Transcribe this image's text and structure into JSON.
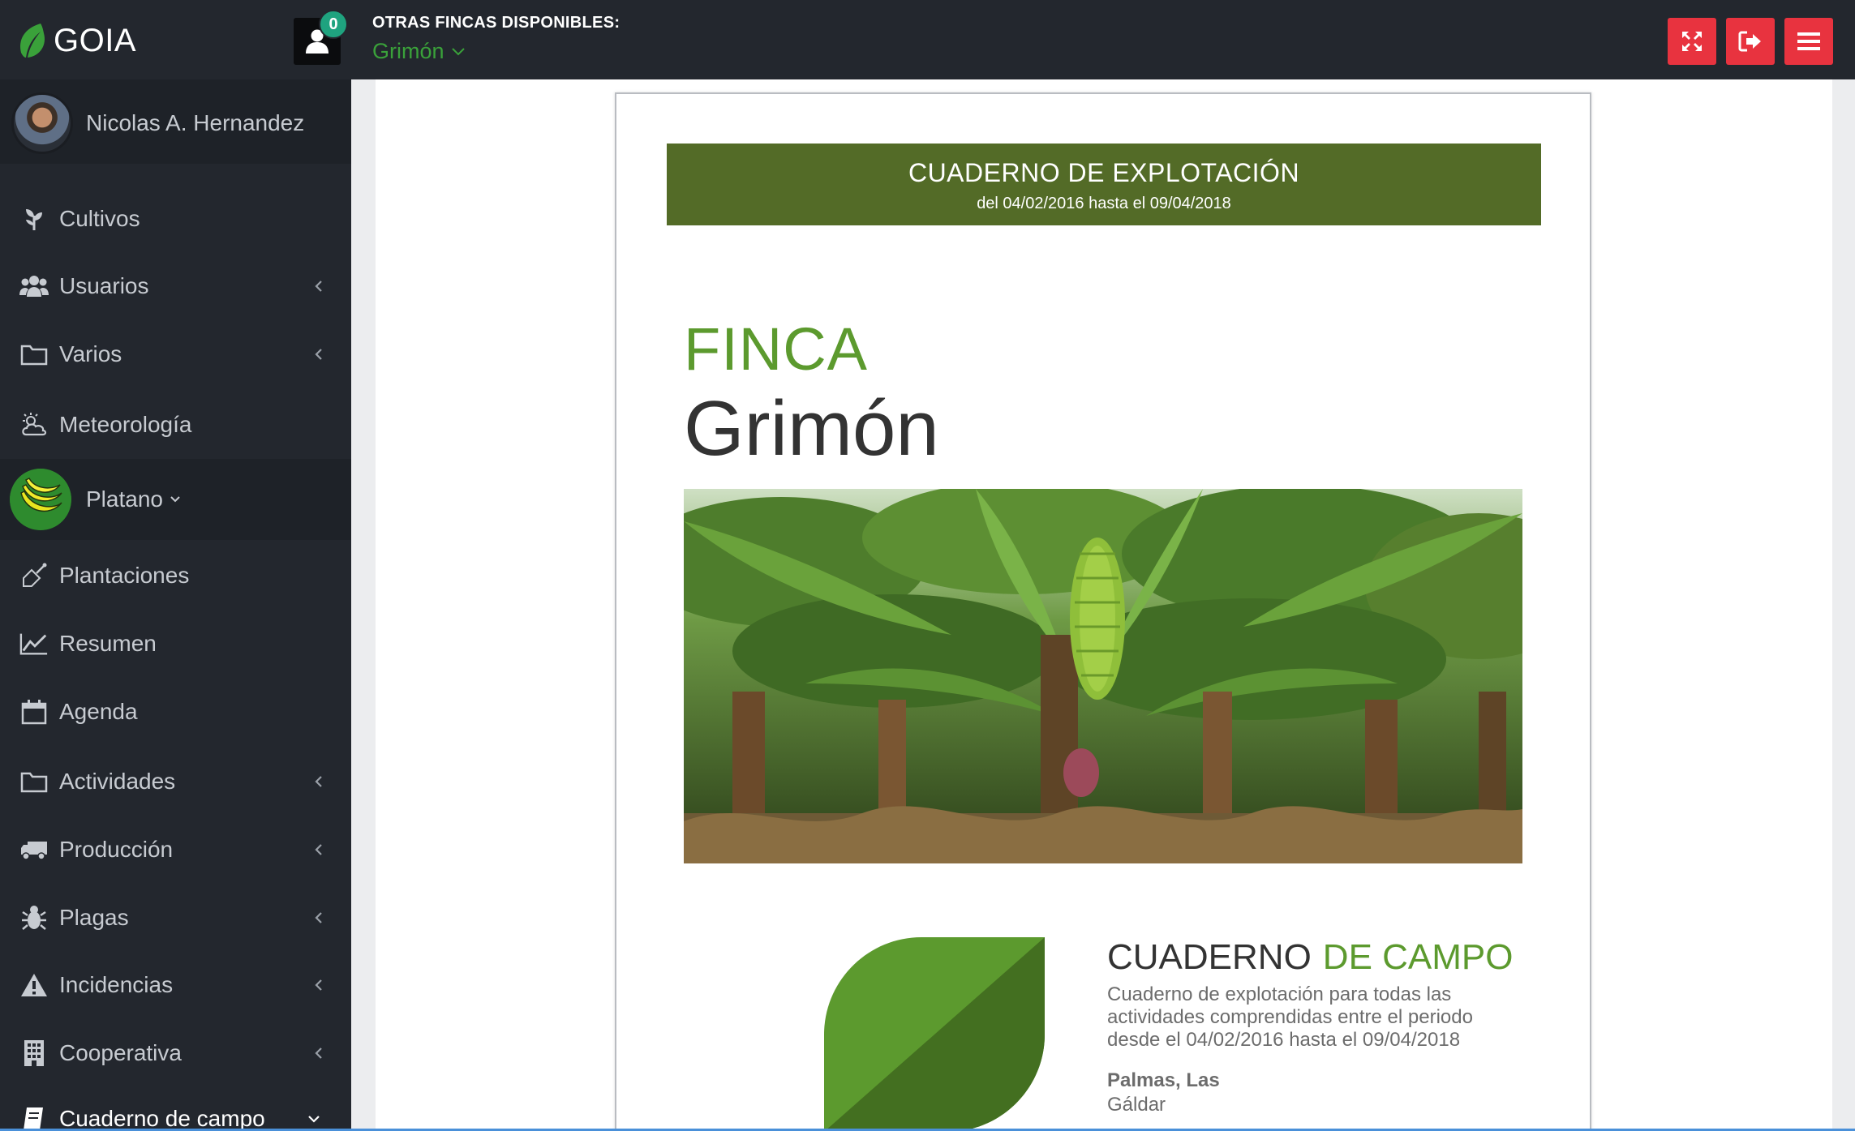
{
  "header": {
    "brand": "GOIA",
    "notifications_count": "0",
    "farms_label": "OTRAS FINCAS DISPONIBLES:",
    "selected_farm": "Grimón",
    "buttons": [
      "expand-icon",
      "logout-icon",
      "menu-icon"
    ],
    "accent_color": "#e8333f"
  },
  "sidebar": {
    "user_name": "Nicolas A. Hernandez",
    "items": [
      {
        "label": "Cultivos",
        "icon": "plant-icon",
        "has_children": false
      },
      {
        "label": "Usuarios",
        "icon": "users-icon",
        "has_children": true
      },
      {
        "label": "Varios",
        "icon": "folder-icon",
        "has_children": true
      },
      {
        "label": "Meteorología",
        "icon": "weather-icon",
        "has_children": false
      }
    ],
    "crop": {
      "label": "Platano",
      "icon": "banana-icon"
    },
    "crop_items": [
      {
        "label": "Plantaciones",
        "icon": "planting-icon",
        "has_children": false
      },
      {
        "label": "Resumen",
        "icon": "chart-line-icon",
        "has_children": false
      },
      {
        "label": "Agenda",
        "icon": "calendar-icon",
        "has_children": false
      },
      {
        "label": "Actividades",
        "icon": "folder-icon",
        "has_children": true
      },
      {
        "label": "Producción",
        "icon": "truck-icon",
        "has_children": true
      },
      {
        "label": "Plagas",
        "icon": "bug-icon",
        "has_children": true
      },
      {
        "label": "Incidencias",
        "icon": "warning-icon",
        "has_children": true
      },
      {
        "label": "Cooperativa",
        "icon": "building-icon",
        "has_children": true
      },
      {
        "label": "Cuaderno de campo",
        "icon": "notebook-icon",
        "has_children": true,
        "expanded": true
      }
    ]
  },
  "document": {
    "title": "CUADERNO DE EXPLOTACIÓN",
    "period": "del 04/02/2016 hasta el 09/04/2018",
    "finca_label": "FINCA",
    "finca_name": "Grimón",
    "cover_title_1": "CUADERNO",
    "cover_title_2": "DE CAMPO",
    "description": "Cuaderno de explotación para todas las actividades comprendidas entre el periodo desde el 04/02/2016 hasta el 09/04/2018",
    "region": "Palmas, Las",
    "town": "Gáldar",
    "header_color": "#536b27",
    "green_color": "#5c9a2e"
  }
}
